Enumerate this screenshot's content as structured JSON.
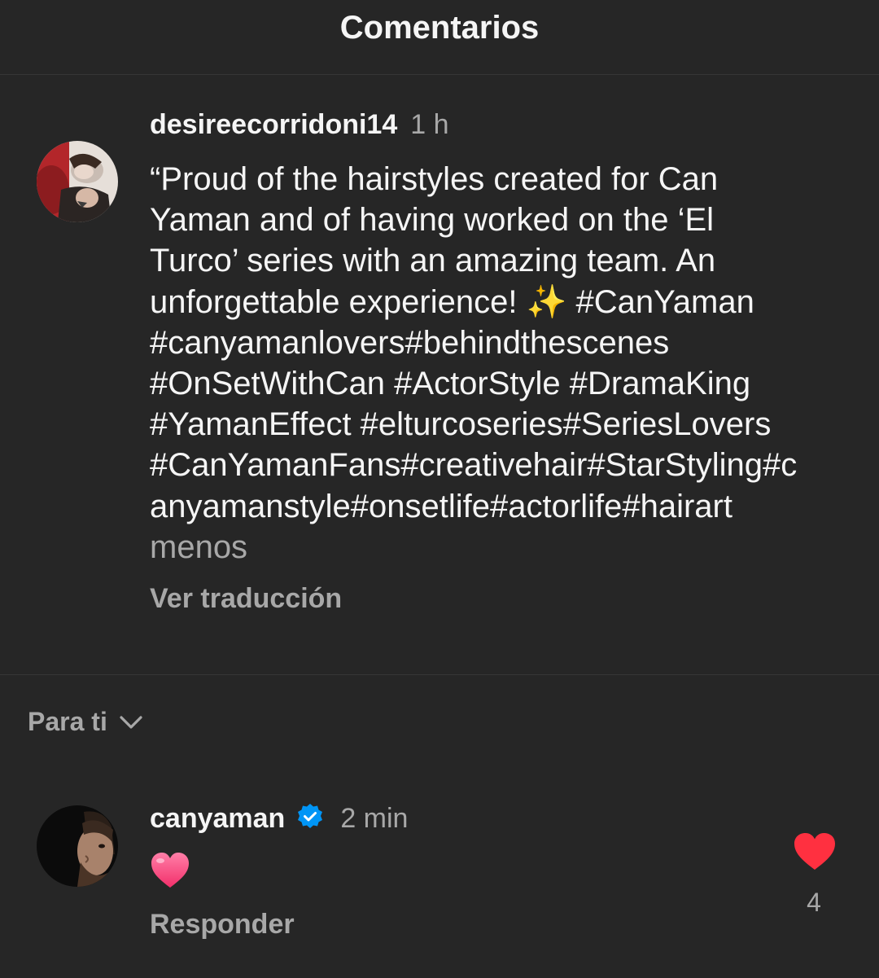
{
  "header": {
    "title": "Comentarios"
  },
  "caption": {
    "username": "desireecorridoni14",
    "time": "1 h",
    "lines": [
      "“Proud of the hairstyles created for Can",
      "Yaman and of having worked on the ‘El",
      "Turco’ series with an amazing team. An",
      "unforgettable experience! ✨ #CanYaman",
      "#canyamanlovers#behindthescenes",
      "#OnSetWithCan #ActorStyle #DramaKing",
      "#YamanEffect #elturcoseries#SeriesLovers",
      "#CanYamanFans#creativehair#StarStyling#c",
      "anyamanstyle#onsetlife#actorlife#hairart"
    ],
    "less_label": "menos",
    "see_translation": "Ver traducción"
  },
  "sort": {
    "label": "Para ti",
    "icon": "chevron-down-icon"
  },
  "comment": {
    "username": "canyaman",
    "verified_icon": "verified-badge-icon",
    "time": "2 min",
    "body_icon": "pink-heart-emoji",
    "reply_label": "Responder",
    "like_icon": "heart-filled-icon",
    "like_count": "4"
  },
  "colors": {
    "background": "#262626",
    "primary_text": "#f5f5f5",
    "secondary_text": "#a8a8a8",
    "verified_blue": "#0095f6",
    "like_red": "#ff3040",
    "divider": "#363636"
  }
}
